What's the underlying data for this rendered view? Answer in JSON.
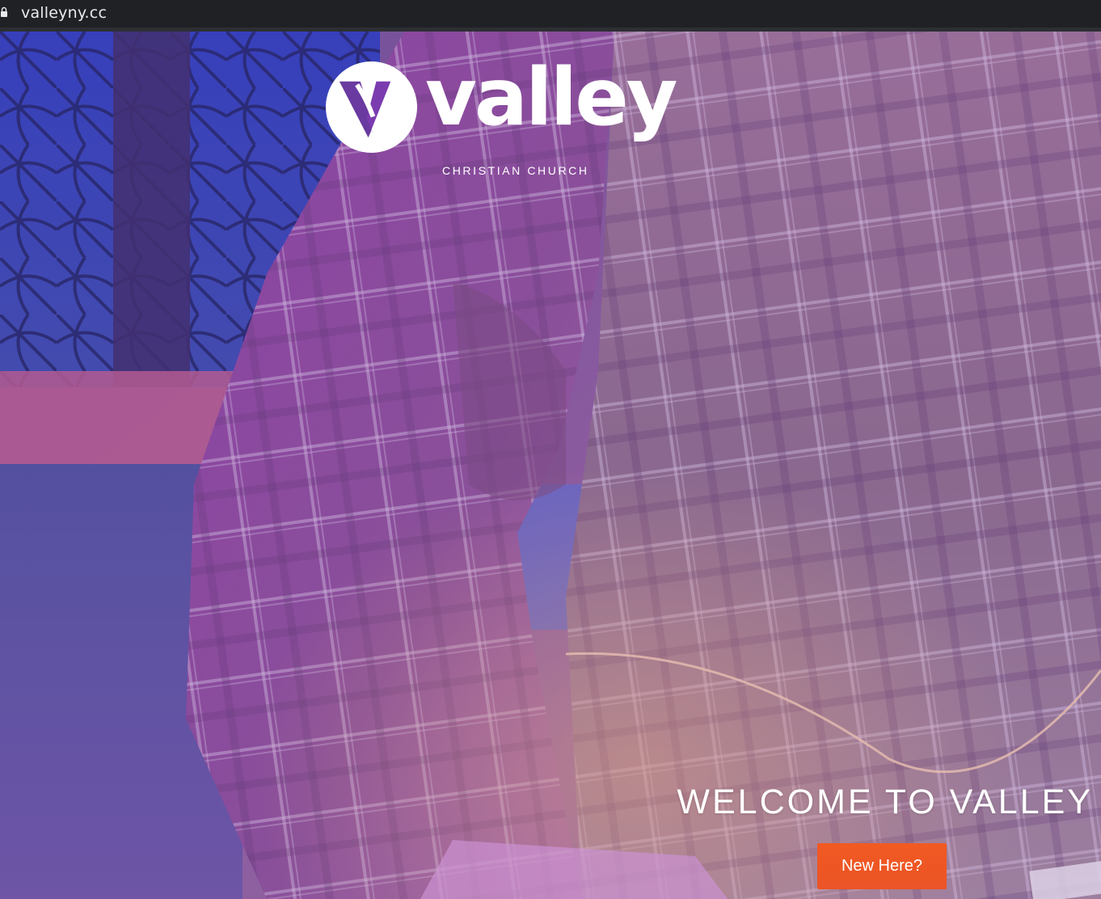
{
  "browser": {
    "url": "valleyny.cc",
    "lock_icon": "lock-icon"
  },
  "logo": {
    "word": "valley",
    "subtitle": "CHRISTIAN CHURCH",
    "mark_icon": "valley-v-logo-icon"
  },
  "hero": {
    "headline": "WELCOME TO VALLEY",
    "cta_label": "New Here?",
    "cta_color": "#f05a24",
    "overlay_color": "#8a5aa8",
    "background": "photo of guitarist in plaid shirt in front of stained glass, purple tint"
  }
}
